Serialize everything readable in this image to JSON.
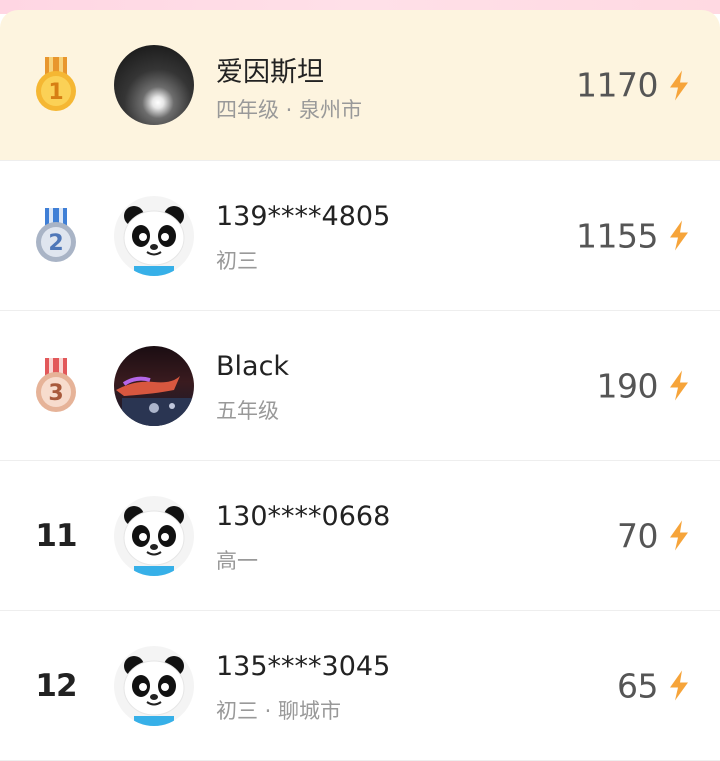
{
  "colors": {
    "gold": "#f5b733",
    "silver": "#a9b4c6",
    "bronze": "#e6b398",
    "bolt": "#f6a43a",
    "highlight": "#fdf4df"
  },
  "rows": [
    {
      "rank": "1",
      "medal": "gold",
      "avatar": "moon-photo",
      "name": "爱因斯坦",
      "sub": "四年级 · 泉州市",
      "score": "1170"
    },
    {
      "rank": "2",
      "medal": "silver",
      "avatar": "panda",
      "name": "139****4805",
      "sub": "初三",
      "score": "1155"
    },
    {
      "rank": "3",
      "medal": "bronze",
      "avatar": "night-photo",
      "name": "Black",
      "sub": "五年级",
      "score": "190"
    },
    {
      "rank": "11",
      "medal": "",
      "avatar": "panda",
      "name": "130****0668",
      "sub": "高一",
      "score": "70"
    },
    {
      "rank": "12",
      "medal": "",
      "avatar": "panda",
      "name": "135****3045",
      "sub": "初三 · 聊城市",
      "score": "65"
    }
  ]
}
